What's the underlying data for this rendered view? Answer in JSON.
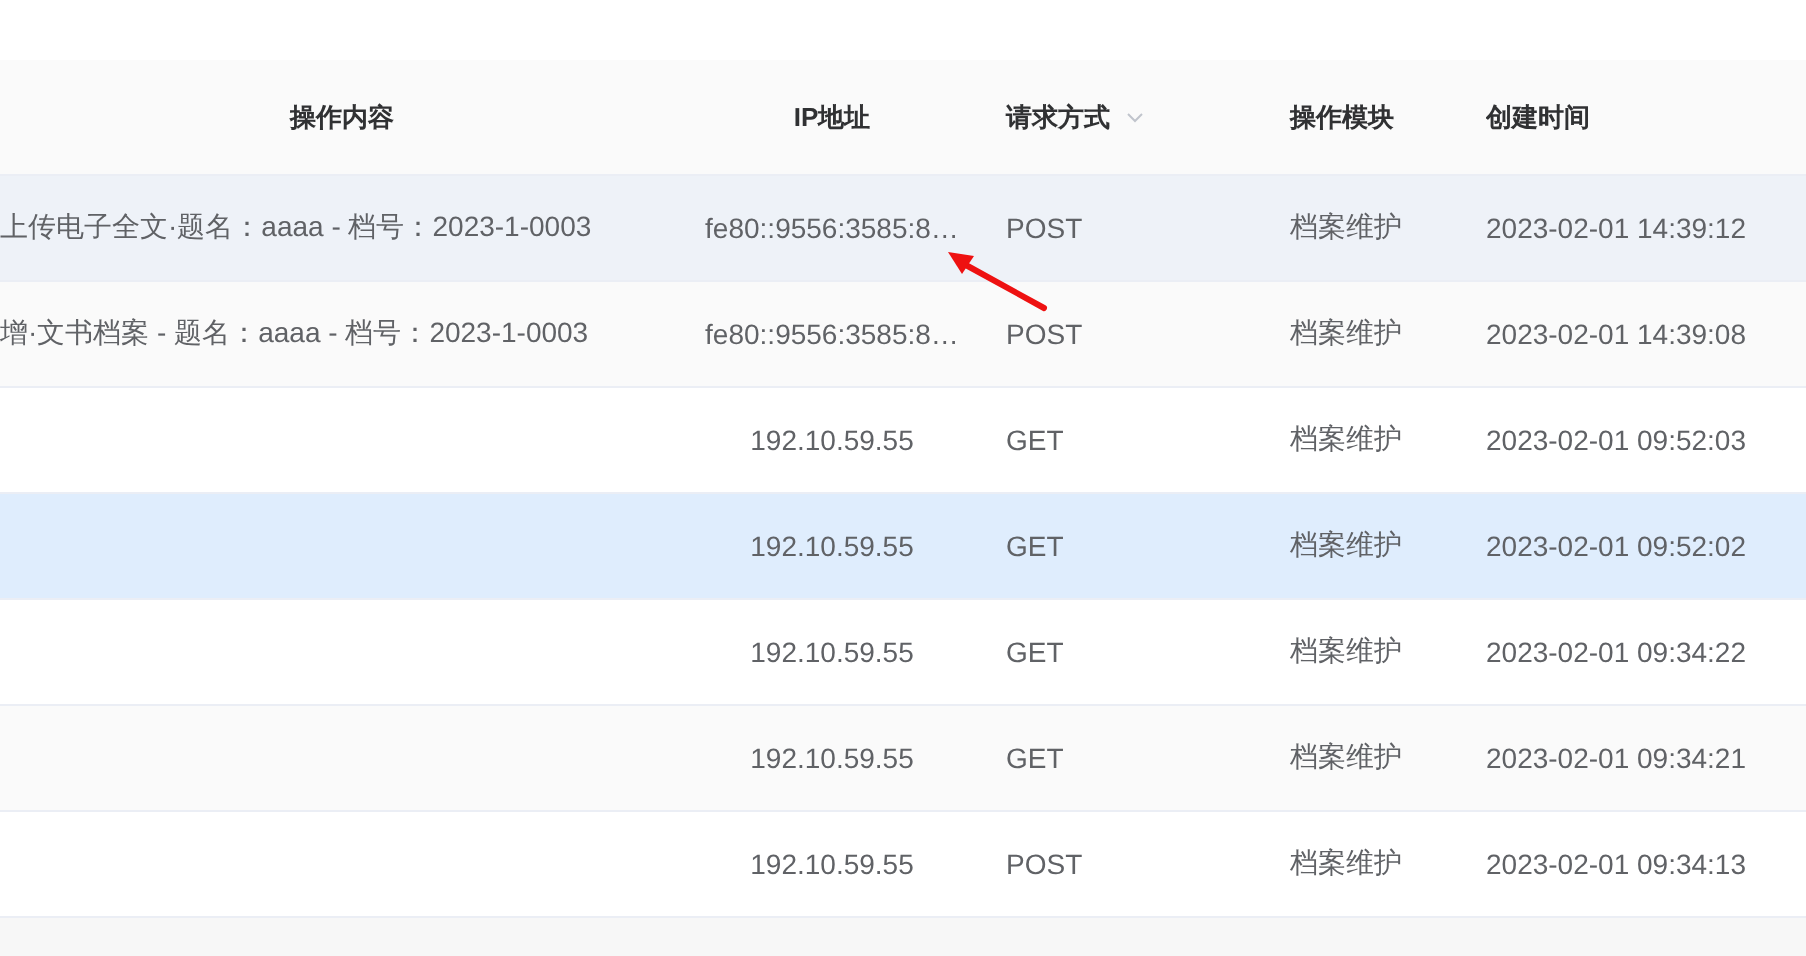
{
  "table": {
    "columns": [
      {
        "label": "操作内容",
        "sortable": false
      },
      {
        "label": "IP地址",
        "sortable": false
      },
      {
        "label": "请求方式",
        "sortable": true
      },
      {
        "label": "操作模块",
        "sortable": false
      },
      {
        "label": "创建时间",
        "sortable": false
      }
    ],
    "rows": [
      {
        "cells": [
          "上传电子全文·题名：aaaa - 档号：2023-1-0003",
          "fe80::9556:3585:8…",
          "POST",
          "档案维护",
          "2023-02-01 14:39:12"
        ],
        "hovered": true,
        "selected": false
      },
      {
        "cells": [
          "增·文书档案 - 题名：aaaa - 档号：2023-1-0003",
          "fe80::9556:3585:8…",
          "POST",
          "档案维护",
          "2023-02-01 14:39:08"
        ],
        "hovered": false,
        "selected": false
      },
      {
        "cells": [
          "",
          "192.10.59.55",
          "GET",
          "档案维护",
          "2023-02-01 09:52:03"
        ],
        "hovered": false,
        "selected": false
      },
      {
        "cells": [
          "",
          "192.10.59.55",
          "GET",
          "档案维护",
          "2023-02-01 09:52:02"
        ],
        "hovered": false,
        "selected": true
      },
      {
        "cells": [
          "",
          "192.10.59.55",
          "GET",
          "档案维护",
          "2023-02-01 09:34:22"
        ],
        "hovered": false,
        "selected": false
      },
      {
        "cells": [
          "",
          "192.10.59.55",
          "GET",
          "档案维护",
          "2023-02-01 09:34:21"
        ],
        "hovered": false,
        "selected": false
      },
      {
        "cells": [
          "",
          "192.10.59.55",
          "POST",
          "档案维护",
          "2023-02-01 09:34:13"
        ],
        "hovered": false,
        "selected": false
      }
    ]
  }
}
